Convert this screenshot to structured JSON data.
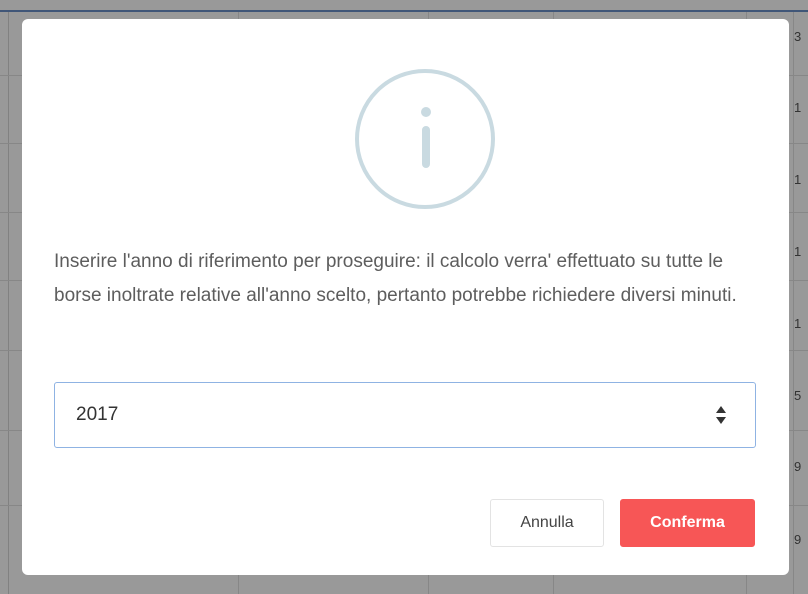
{
  "background": {
    "right_column_cells": [
      "3",
      "1",
      "1",
      "1",
      "1",
      "5",
      "9",
      "9"
    ]
  },
  "dialog": {
    "message": "Inserire l'anno di riferimento per proseguire: il calcolo verra' effettuato su tutte le borse inoltrate relative all'anno scelto, pertanto potrebbe richiedere diversi minuti.",
    "year_value": "2017",
    "cancel_label": "Annulla",
    "confirm_label": "Conferma",
    "icon": "info-icon"
  },
  "colors": {
    "confirm_button": "#f75656",
    "info_icon": "#c9dae1",
    "input_border": "#8fb3e3"
  }
}
